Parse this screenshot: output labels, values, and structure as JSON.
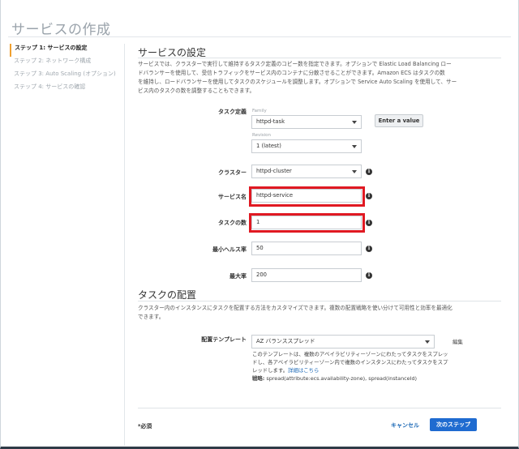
{
  "page": {
    "title": "サービスの作成"
  },
  "steps": [
    {
      "label": "ステップ 1: サービスの設定",
      "active": true
    },
    {
      "label": "ステップ 2: ネットワーク構成",
      "active": false
    },
    {
      "label": "ステップ 3: Auto Scaling (オプション)",
      "active": false
    },
    {
      "label": "ステップ 4: サービスの確認",
      "active": false
    }
  ],
  "service_settings": {
    "title": "サービスの設定",
    "description_lines": [
      "サービスでは、クラスターで実行して維持するタスク定義のコピー数を指定できます。オプションで Elastic Load Balancing ロー",
      "ドバランサーを使用して、受信トラフィックをサービス内のコンテナに分散させることができます。Amazon ECS はタスクの数",
      "を維持し、ロードバランサーを使用してタスクのスケジュールを調整します。オプションで Service Auto Scaling を使用して、サー",
      "ビス内のタスクの数を調整することもできます。"
    ],
    "task_definition": {
      "label": "タスク定義",
      "family_label": "Family",
      "family_value": "httpd-task",
      "enter_value_button": "Enter a value",
      "revision_label": "Revision",
      "revision_value": "1 (latest)"
    },
    "cluster": {
      "label": "クラスター",
      "value": "httpd-cluster"
    },
    "service_name": {
      "label": "サービス名",
      "value": "httpd-service"
    },
    "task_count": {
      "label": "タスクの数",
      "value": "1"
    },
    "min_healthy": {
      "label": "最小ヘルス率",
      "value": "50"
    },
    "max_percent": {
      "label": "最大率",
      "value": "200"
    }
  },
  "placement": {
    "title": "タスクの配置",
    "description_lines": [
      "クラスター内のインスタンスにタスクを配置する方法をカスタマイズできます。複数の配置戦略を使い分けて可用性と効率を最適化",
      "できます。"
    ],
    "template_label": "配置テンプレート",
    "template_value": "AZ バランススプレッド",
    "edit_link": "編集",
    "help_lines": [
      "このテンプレートは、複数のアベイラビリティーゾーンにわたってタスクをスプレッ",
      "ドし、各アベイラビリティーゾーン内で複数のインスタンスにわたってタスクをスプ"
    ],
    "help_last_prefix": "レッドします。",
    "details_link": "詳細はこちら",
    "strategy_label": "戦略:",
    "strategy_value": "spread(attribute:ecs.availability-zone), spread(instanceId)"
  },
  "footer": {
    "required_note": "*必須",
    "cancel_label": "キャンセル",
    "next_label": "次のステップ"
  },
  "colors": {
    "highlight": "#e01922",
    "primary_button": "#1f6bd0",
    "link": "#1f6bb7",
    "active_step_marker": "#f0a030"
  }
}
